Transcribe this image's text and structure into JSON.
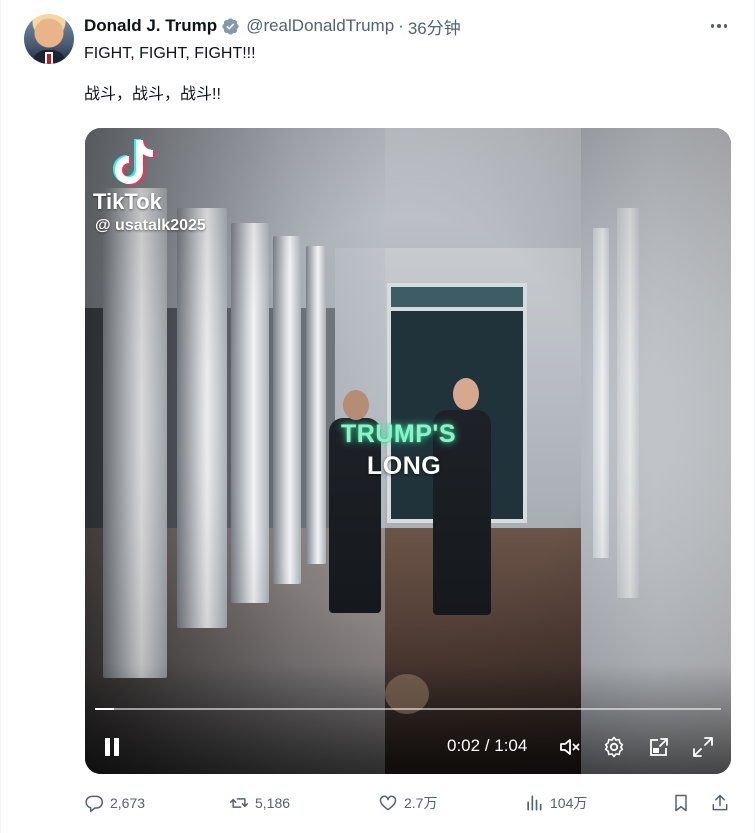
{
  "tweet": {
    "author": {
      "display_name": "Donald J. Trump",
      "handle": "@realDonaldTrump",
      "separator": "·",
      "time_ago": "36分钟",
      "verified_color": "#829aab"
    },
    "text_lines": [
      "FIGHT, FIGHT, FIGHT!!!",
      "战斗，战斗，战斗!!"
    ],
    "menu_icon": "more-horizontal-icon"
  },
  "media": {
    "overlay": {
      "brand": "TikTok",
      "username": "@ usatalk2025",
      "caption_lines": [
        "TRUMP'S",
        "LONG"
      ],
      "caption_accent_color": "#8ff2c8"
    },
    "player": {
      "time_display": "0:02 / 1:04",
      "progress_fraction": 0.03,
      "controls": [
        "pause-icon",
        "mute-icon",
        "settings-icon",
        "picture-in-picture-icon",
        "fullscreen-icon"
      ]
    }
  },
  "actions": {
    "replies": "2,673",
    "reposts": "5,186",
    "likes": "2.7万",
    "views": "104万",
    "icons": [
      "reply-icon",
      "repost-icon",
      "like-icon",
      "views-icon",
      "bookmark-icon",
      "share-icon"
    ]
  }
}
